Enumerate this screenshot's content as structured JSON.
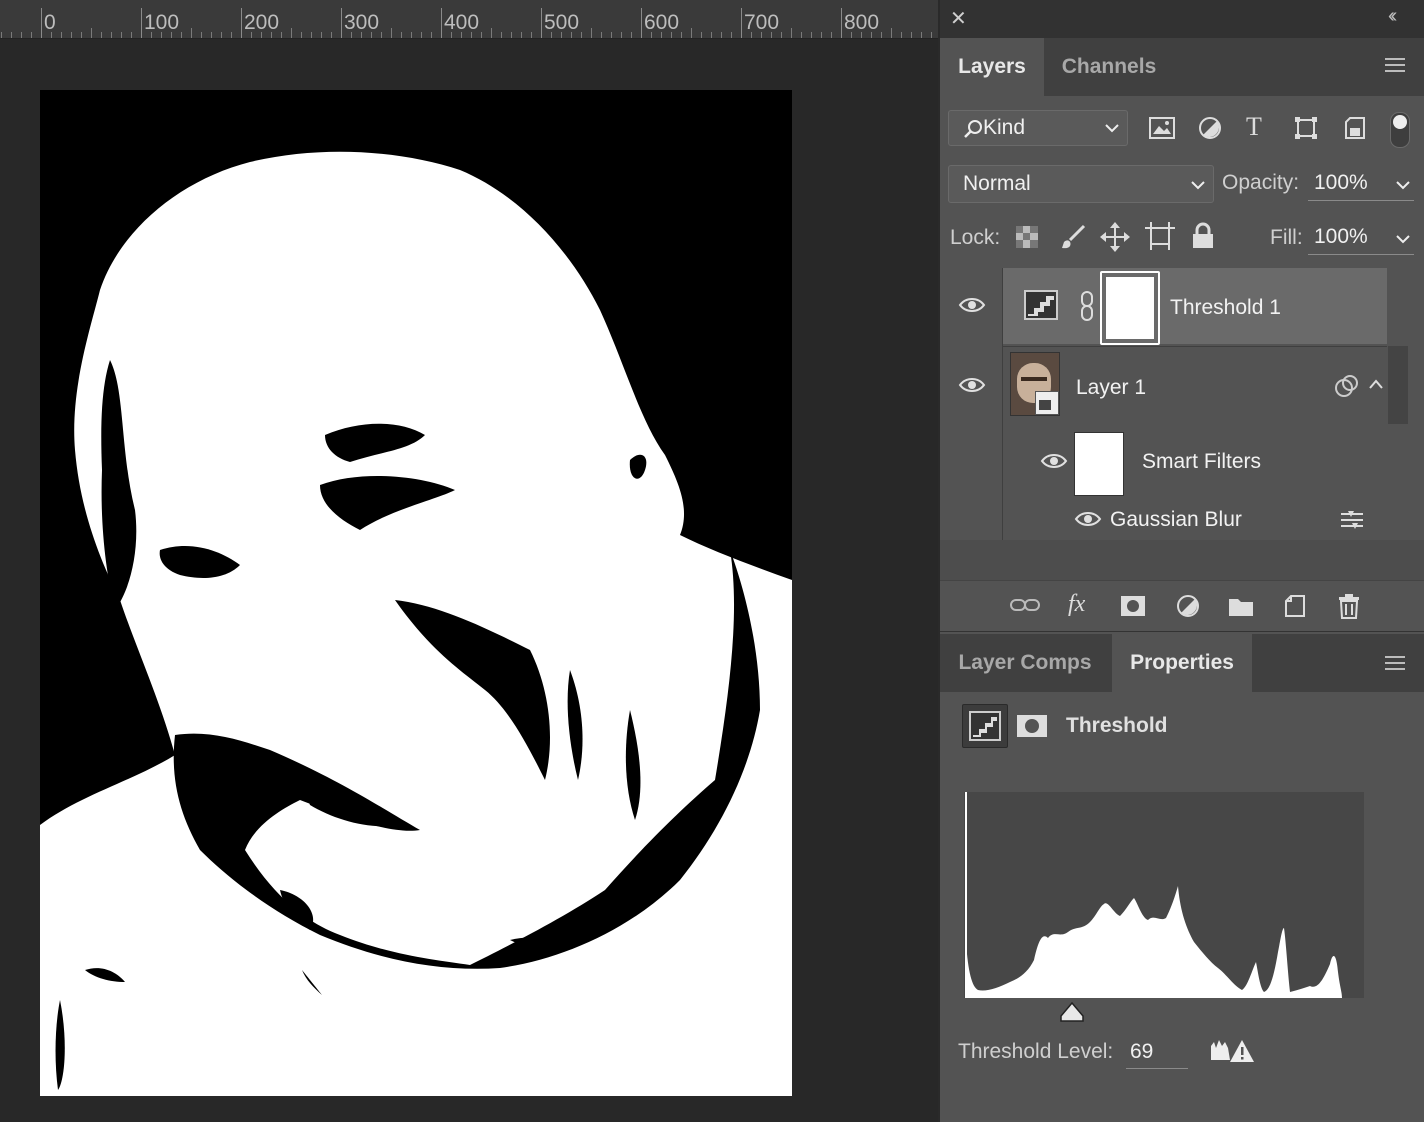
{
  "ruler": {
    "labels": [
      "0",
      "100",
      "200",
      "300",
      "400",
      "500",
      "600",
      "700",
      "800"
    ]
  },
  "panel": {
    "close_glyph": "✕",
    "collapse_glyph": "‹‹",
    "layers_tabs": [
      "Layers",
      "Channels"
    ],
    "filter_kind": "Kind",
    "blend_mode": "Normal",
    "opacity_label": "Opacity:",
    "opacity_value": "100%",
    "lock_label": "Lock:",
    "fill_label": "Fill:",
    "fill_value": "100%",
    "layers": [
      {
        "name": "Threshold 1",
        "type": "adjustment",
        "selected": true
      },
      {
        "name": "Layer 1",
        "type": "smart-object"
      }
    ],
    "smart_filters_label": "Smart Filters",
    "filter_name": "Gaussian Blur",
    "fx_label": "fx",
    "lower_tabs": [
      "Layer Comps",
      "Properties"
    ],
    "properties_title": "Threshold",
    "threshold_level_label": "Threshold Level:",
    "threshold_level_value": "69",
    "threshold_level": 69,
    "accent_colors": {
      "panel": "#535353",
      "dark": "#323232",
      "histogram_bg": "#474747"
    }
  }
}
